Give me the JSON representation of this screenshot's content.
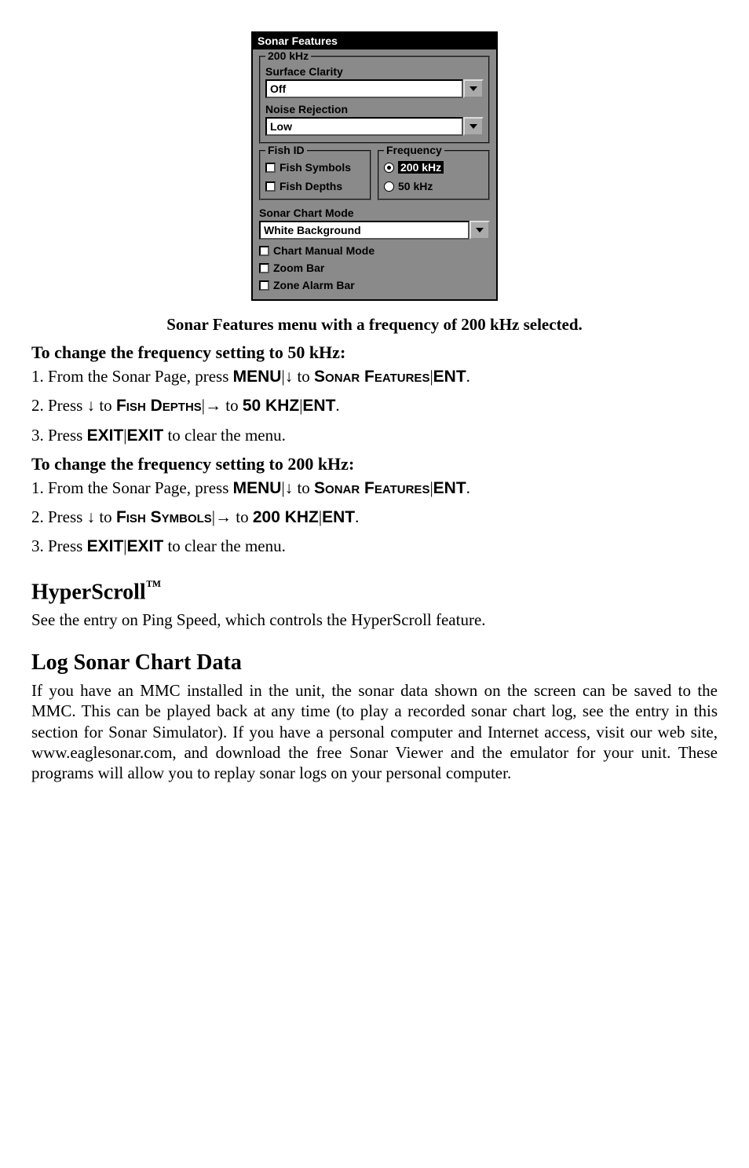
{
  "dialog": {
    "title": "Sonar Features",
    "group200": {
      "title": "200 kHz",
      "surface_clarity_label": "Surface Clarity",
      "surface_clarity_value": "Off",
      "noise_rejection_label": "Noise Rejection",
      "noise_rejection_value": "Low"
    },
    "fish_id": {
      "title": "Fish ID",
      "fish_symbols_label": "Fish Symbols",
      "fish_symbols_checked": false,
      "fish_depths_label": "Fish Depths",
      "fish_depths_checked": false
    },
    "frequency": {
      "title": "Frequency",
      "opt_200_label": "200 kHz",
      "opt_50_label": "50 kHz",
      "selected": "200"
    },
    "sonar_chart_mode_label": "Sonar Chart Mode",
    "sonar_chart_mode_value": "White Background",
    "chart_manual_mode_label": "Chart Manual Mode",
    "zoom_bar_label": "Zoom Bar",
    "zone_alarm_bar_label": "Zone Alarm Bar"
  },
  "caption": "Sonar Features menu with a frequency of 200 kHz selected.",
  "sec50": {
    "heading": "To change the frequency setting to 50 kHz:",
    "step1_a": "1. From the Sonar Page, press ",
    "step1_menu": "MENU",
    "step1_to": " to ",
    "step1_target": "Sonar Features",
    "step1_ent": "ENT",
    "step2_a": "2. Press ",
    "step2_to": " to ",
    "step2_target": "Fish Depths",
    "step2_to2": " to ",
    "step2_val": "50 KHZ",
    "step2_ent": "ENT",
    "step3_a": "3. Press ",
    "step3_exit": "EXIT",
    "step3_tail": " to clear the menu."
  },
  "sec200": {
    "heading": "To change the frequency setting to 200 kHz:",
    "step1_a": "1. From the Sonar Page, press ",
    "step1_menu": "MENU",
    "step1_to": " to ",
    "step1_target": "Sonar Features",
    "step1_ent": "ENT",
    "step2_a": "2. Press ",
    "step2_to": " to ",
    "step2_target": "Fish Symbols",
    "step2_to2": " to ",
    "step2_val": "200 KHZ",
    "step2_ent": "ENT",
    "step3_a": "3. Press ",
    "step3_exit": "EXIT",
    "step3_tail": " to clear the menu."
  },
  "hyperscroll": {
    "title": "HyperScroll",
    "tm": "™",
    "body": "See the entry on Ping Speed, which controls the HyperScroll feature."
  },
  "logdata": {
    "title": "Log Sonar Chart Data",
    "body": "If you have an MMC installed in the unit, the sonar data shown on the screen can be saved to the MMC. This can be played back at any time (to play a recorded sonar chart log, see the entry in this section for Sonar Simulator). If you have a personal computer and Internet access, visit our web site, www.eaglesonar.com, and download the free Sonar Viewer and the emulator for your unit. These programs will allow you to replay sonar logs on your personal computer."
  },
  "glyphs": {
    "down_arrow": "↓",
    "right_arrow": "→",
    "pipe": "|",
    "period": "."
  }
}
